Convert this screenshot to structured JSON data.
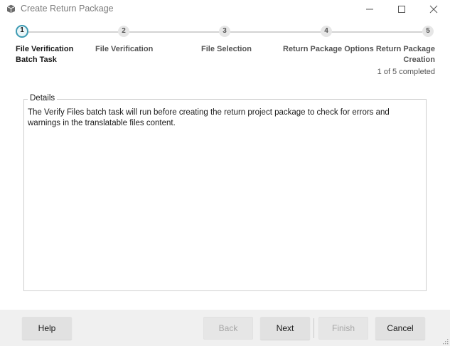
{
  "window": {
    "title": "Create Return Package",
    "app_icon": "package-icon",
    "controls": [
      "minimize-icon",
      "maximize-icon",
      "close-icon"
    ]
  },
  "steps": [
    {
      "number": "1",
      "label_line1": "File Verification",
      "label_line2": "Batch Task",
      "active": true
    },
    {
      "number": "2",
      "label_line1": "File Verification",
      "label_line2": "",
      "active": false
    },
    {
      "number": "3",
      "label_line1": "File Selection",
      "label_line2": "",
      "active": false
    },
    {
      "number": "4",
      "label_line1": "Return Package Options",
      "label_line2": "",
      "active": false
    },
    {
      "number": "5",
      "label_line1": "Return Package",
      "label_line2": "Creation",
      "active": false
    }
  ],
  "progress": {
    "text": "1 of 5 completed",
    "completed": 1,
    "total": 5
  },
  "details": {
    "legend": "Details",
    "text": "The Verify Files batch task will run before creating the return project package to check for errors and warnings in the translatable files content."
  },
  "buttons": {
    "help": "Help",
    "back": "Back",
    "next": "Next",
    "finish": "Finish",
    "cancel": "Cancel"
  },
  "colors": {
    "accent": "#3d9bb3",
    "footer_bg": "#f0f0f0",
    "button_bg": "#e1e1e1",
    "disabled_text": "#a6a6a6"
  }
}
